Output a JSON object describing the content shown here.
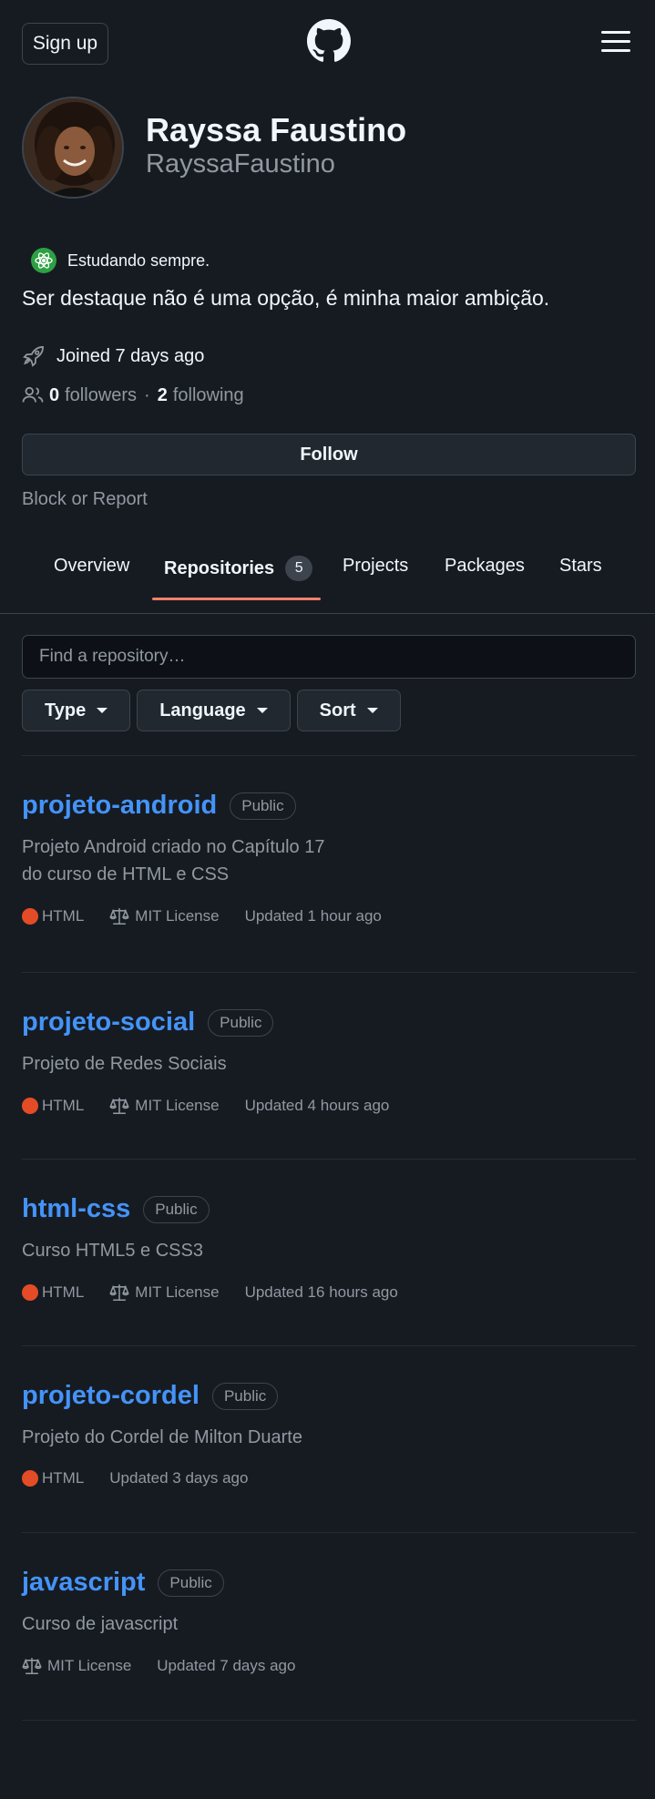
{
  "header": {
    "signup_label": "Sign up"
  },
  "profile": {
    "name": "Rayssa Faustino",
    "login": "RayssaFaustino",
    "status": "Estudando sempre.",
    "bio": "Ser destaque não é uma opção, é minha maior ambição.",
    "joined": "Joined 7 days ago",
    "followers_count": "0",
    "followers_label": "followers",
    "separator": "·",
    "following_count": "2",
    "following_label": "following",
    "follow_label": "Follow",
    "block_label": "Block or Report"
  },
  "tabs": [
    {
      "label": "Overview"
    },
    {
      "label": "Repositories",
      "counter": "5",
      "selected": true
    },
    {
      "label": "Projects"
    },
    {
      "label": "Packages"
    },
    {
      "label": "Stars"
    }
  ],
  "search": {
    "placeholder": "Find a repository…"
  },
  "filters": [
    {
      "label": "Type"
    },
    {
      "label": "Language"
    },
    {
      "label": "Sort"
    }
  ],
  "repos": [
    {
      "name": "projeto-android",
      "visibility": "Public",
      "description": "Projeto Android criado no Capítulo 17\ndo curso de HTML e CSS",
      "language": "HTML",
      "license": "MIT License",
      "updated": "Updated 1 hour ago"
    },
    {
      "name": "projeto-social",
      "visibility": "Public",
      "description": "Projeto de Redes Sociais",
      "language": "HTML",
      "license": "MIT License",
      "updated": "Updated 4 hours ago"
    },
    {
      "name": "html-css",
      "visibility": "Public",
      "description": "Curso HTML5 e CSS3",
      "language": "HTML",
      "license": "MIT License",
      "updated": "Updated 16 hours ago"
    },
    {
      "name": "projeto-cordel",
      "visibility": "Public",
      "description": "Projeto do Cordel de Milton Duarte",
      "language": "HTML",
      "license": "",
      "updated": "Updated 3 days ago"
    },
    {
      "name": "javascript",
      "visibility": "Public",
      "description": "Curso de javascript",
      "language": "",
      "license": "MIT License",
      "updated": "Updated 7 days ago"
    }
  ],
  "colors": {
    "background": "#161b22",
    "link": "#4493f8",
    "html_language": "#e34c26",
    "tab_underline": "#f78166"
  }
}
